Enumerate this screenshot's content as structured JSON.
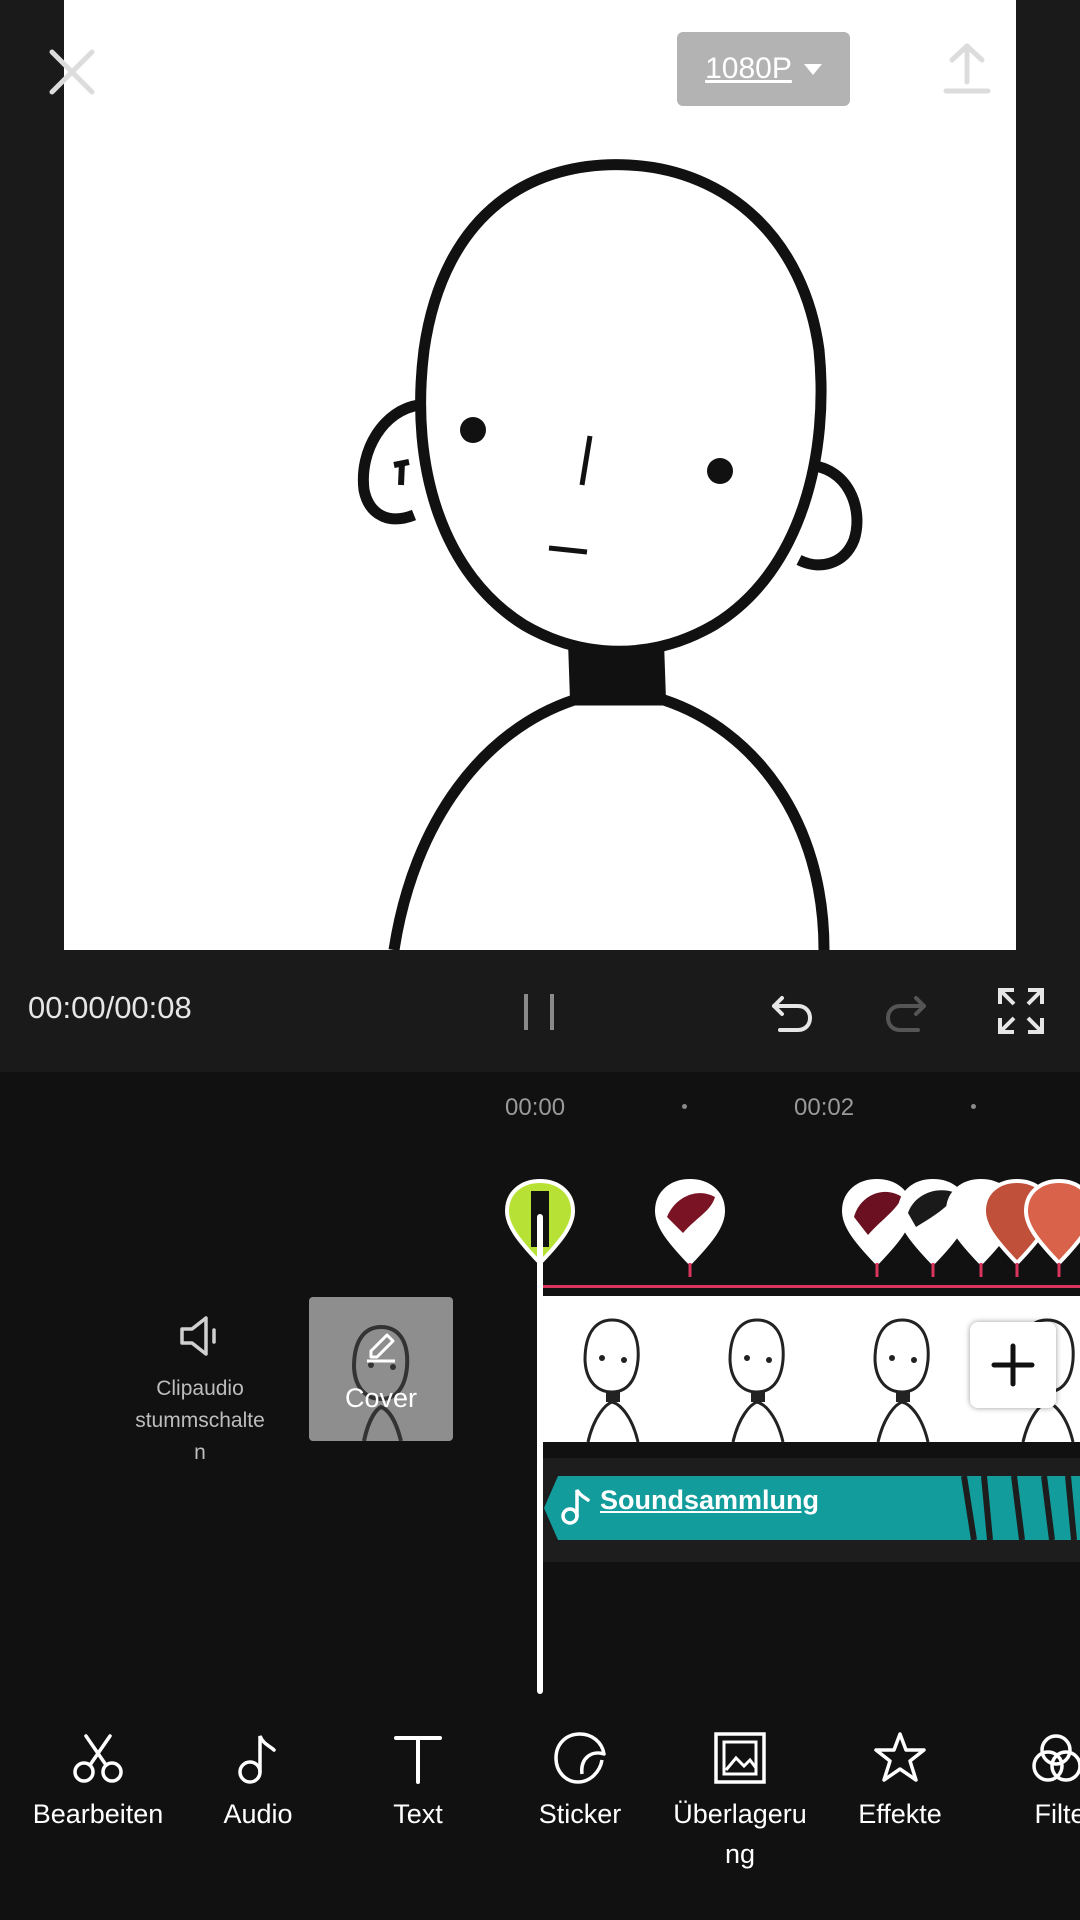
{
  "header": {
    "resolution": "1080P",
    "close_icon": "close-icon",
    "export_icon": "export-icon"
  },
  "player": {
    "time": "00:00/00:08",
    "pause_icon": "pause-icon",
    "undo_icon": "undo-icon",
    "redo_icon": "redo-icon",
    "fullscreen_icon": "fullscreen-icon"
  },
  "timeline": {
    "ruler": [
      "00:00",
      "00:02"
    ],
    "mute_label": "Clipaudio\nstummschalte\nn",
    "cover_label": "Cover",
    "audio_label": "Soundsammlung"
  },
  "toolbar": {
    "items": [
      {
        "label": "Bearbeiten",
        "icon": "scissors-icon"
      },
      {
        "label": "Audio",
        "icon": "music-note-icon"
      },
      {
        "label": "Text",
        "icon": "text-icon"
      },
      {
        "label": "Sticker",
        "icon": "sticker-icon"
      },
      {
        "label": "Überlageru\nng",
        "icon": "overlay-icon"
      },
      {
        "label": "Effekte",
        "icon": "effects-star-icon"
      },
      {
        "label": "Filte",
        "icon": "filter-icon"
      }
    ]
  },
  "colors": {
    "keyframe_line": "#d9345b",
    "audio_track": "#139c9c"
  }
}
